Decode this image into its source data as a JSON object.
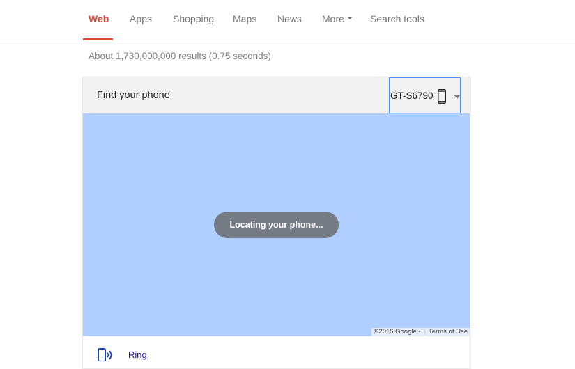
{
  "nav": {
    "tabs": [
      {
        "label": "Web",
        "active": true
      },
      {
        "label": "Apps"
      },
      {
        "label": "Shopping"
      },
      {
        "label": "Maps"
      },
      {
        "label": "News"
      },
      {
        "label": "More"
      },
      {
        "label": "Search tools"
      }
    ],
    "accent_color": "#dd4b39"
  },
  "result_stats": "About 1,730,000,000 results (0.75 seconds)",
  "card": {
    "title": "Find your phone",
    "device": {
      "name": "GT-S6790",
      "icon": "smartphone-icon"
    },
    "map": {
      "background_color": "#b0ceff",
      "status": "Locating your phone...",
      "copyright": "©2015 Google -",
      "terms": "Terms of Use"
    },
    "actions": [
      {
        "label": "Ring",
        "icon": "ring-phone-icon"
      }
    ]
  }
}
